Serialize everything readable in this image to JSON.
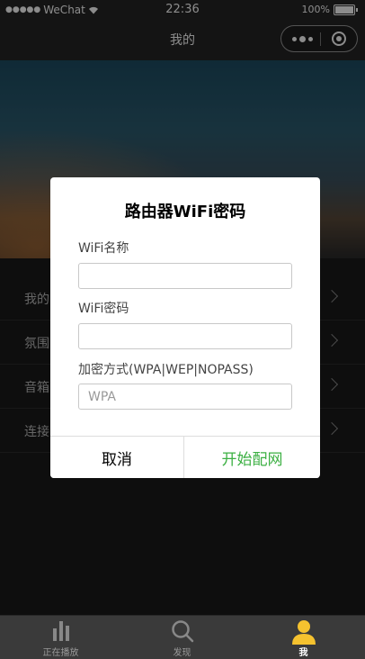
{
  "status_bar": {
    "carrier": "WeChat",
    "time": "22:36",
    "battery_text": "100%"
  },
  "nav": {
    "title": "我的"
  },
  "menu": {
    "items": [
      {
        "label": "我的"
      },
      {
        "label": "氛围"
      },
      {
        "label": "音箱"
      },
      {
        "label": "连接"
      }
    ]
  },
  "dialog": {
    "title": "路由器WiFi密码",
    "ssid_label": "WiFi名称",
    "ssid_value": "",
    "password_label": "WiFi密码",
    "password_value": "",
    "encryption_label": "加密方式(WPA|WEP|NOPASS)",
    "encryption_value": "",
    "encryption_placeholder": "WPA",
    "cancel_label": "取消",
    "confirm_label": "开始配网"
  },
  "tabs": [
    {
      "label": "正在播放",
      "icon": "bar-chart-icon"
    },
    {
      "label": "发现",
      "icon": "search-icon"
    },
    {
      "label": "我",
      "icon": "person-icon",
      "active": true
    }
  ],
  "colors": {
    "accent_green": "#3cb043",
    "active_tab_icon": "#f5c22f"
  }
}
